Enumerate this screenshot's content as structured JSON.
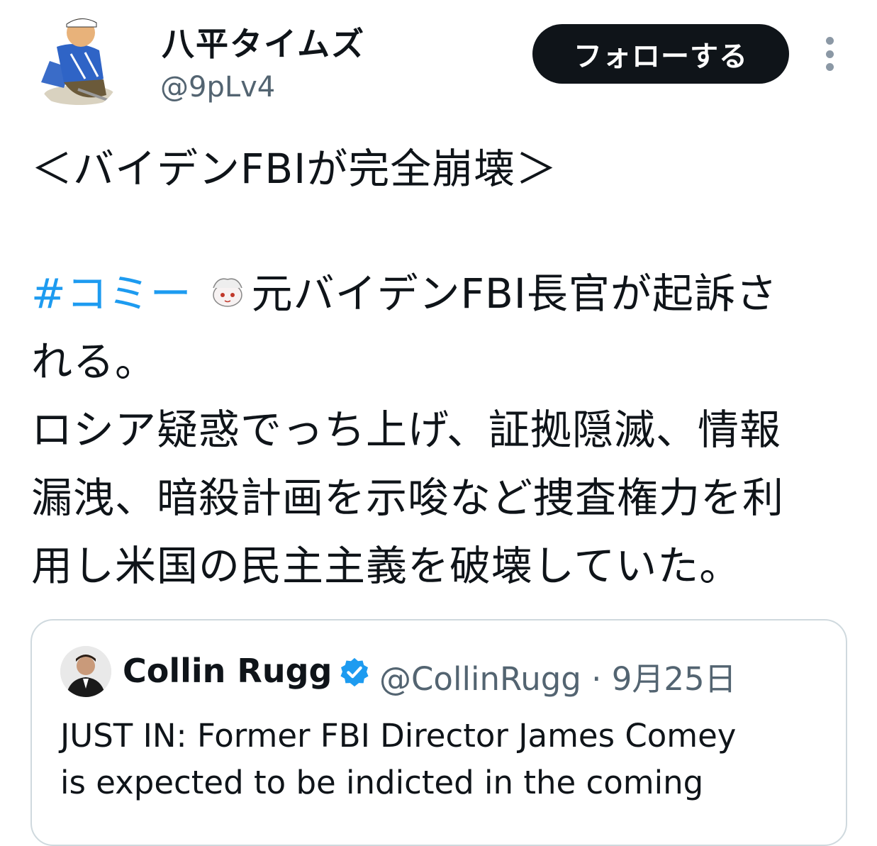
{
  "author": {
    "display_name": "八平タイムズ",
    "handle": "@9pLv4"
  },
  "actions": {
    "follow_label": "フォローする"
  },
  "tweet": {
    "line1": "＜バイデンFBIが完全崩壊＞",
    "hashtag": "#コミー",
    "line3_rest": "元バイデンFBI長官が起訴さ",
    "line4": "れる。",
    "line5": "ロシア疑惑でっち上げ、証拠隠滅、情報",
    "line6": "漏洩、暗殺計画を示唆など捜査権力を利",
    "line7": "用し米国の民主主義を破壊していた。"
  },
  "quote": {
    "name": "Collin Rugg",
    "handle_date": "@CollinRugg · 9月25日",
    "text_line1": "JUST IN: Former FBI Director James Comey",
    "text_line2": "is expected to be indicted in the coming"
  },
  "colors": {
    "accent": "#1d9bf0",
    "text_primary": "#0f1419",
    "text_secondary": "#536471",
    "button_bg": "#0f1419",
    "border": "#cfd9de"
  }
}
